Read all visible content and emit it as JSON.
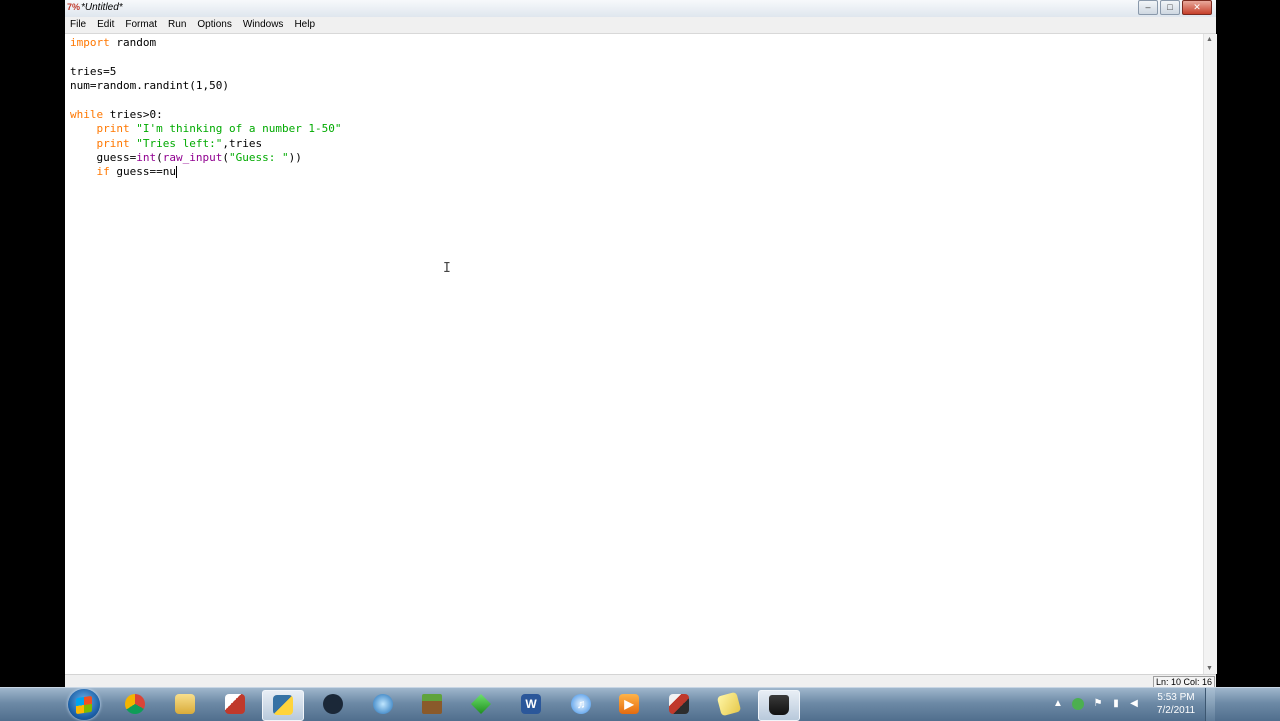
{
  "window": {
    "title": "*Untitled*",
    "app_icon": "python-idle-icon",
    "minimize_glyph": "–",
    "maximize_glyph": "□",
    "close_glyph": "✕"
  },
  "menu": [
    "File",
    "Edit",
    "Format",
    "Run",
    "Options",
    "Windows",
    "Help"
  ],
  "status": {
    "position": "Ln: 10 Col: 16"
  },
  "colors": {
    "keyword": "#ff7700",
    "string": "#00aa00",
    "builtin": "#900090",
    "editor_bg": "#ffffff"
  },
  "taskbar": {
    "apps": [
      "start-orb",
      "chrome-icon",
      "explorer-folder-icon",
      "paint-icon",
      "python-icon",
      "steam-icon",
      "spiral-app-icon",
      "minecraft-icon",
      "sims-icon",
      "word-icon",
      "itunes-icon",
      "media-player-icon",
      "game-icon",
      "notes-icon",
      "tophat-app-icon"
    ],
    "tray_arrow": "▲",
    "clock_time": "5:53 PM",
    "clock_date": "7/2/2011"
  },
  "code": {
    "l1_kw": "import",
    "l1_rest": " random",
    "l3": "tries=5",
    "l4": "num=random.randint(1,50)",
    "l6_kw": "while",
    "l6_rest": " tries>0:",
    "l7_indent": "    ",
    "l7_kw": "print",
    "l7_sp": " ",
    "l7_str": "\"I'm thinking of a number 1-50\"",
    "l8_indent": "    ",
    "l8_kw": "print",
    "l8_sp": " ",
    "l8_str": "\"Tries left:\"",
    "l8_rest": ",tries",
    "l9_indent": "    ",
    "l9_a": "guess=",
    "l9_int": "int",
    "l9_paren": "(",
    "l9_raw": "raw_input",
    "l9_paren2": "(",
    "l9_str": "\"Guess: \"",
    "l9_end": "))",
    "l10_indent": "    ",
    "l10_kw": "if",
    "l10_rest": " guess==nu"
  }
}
